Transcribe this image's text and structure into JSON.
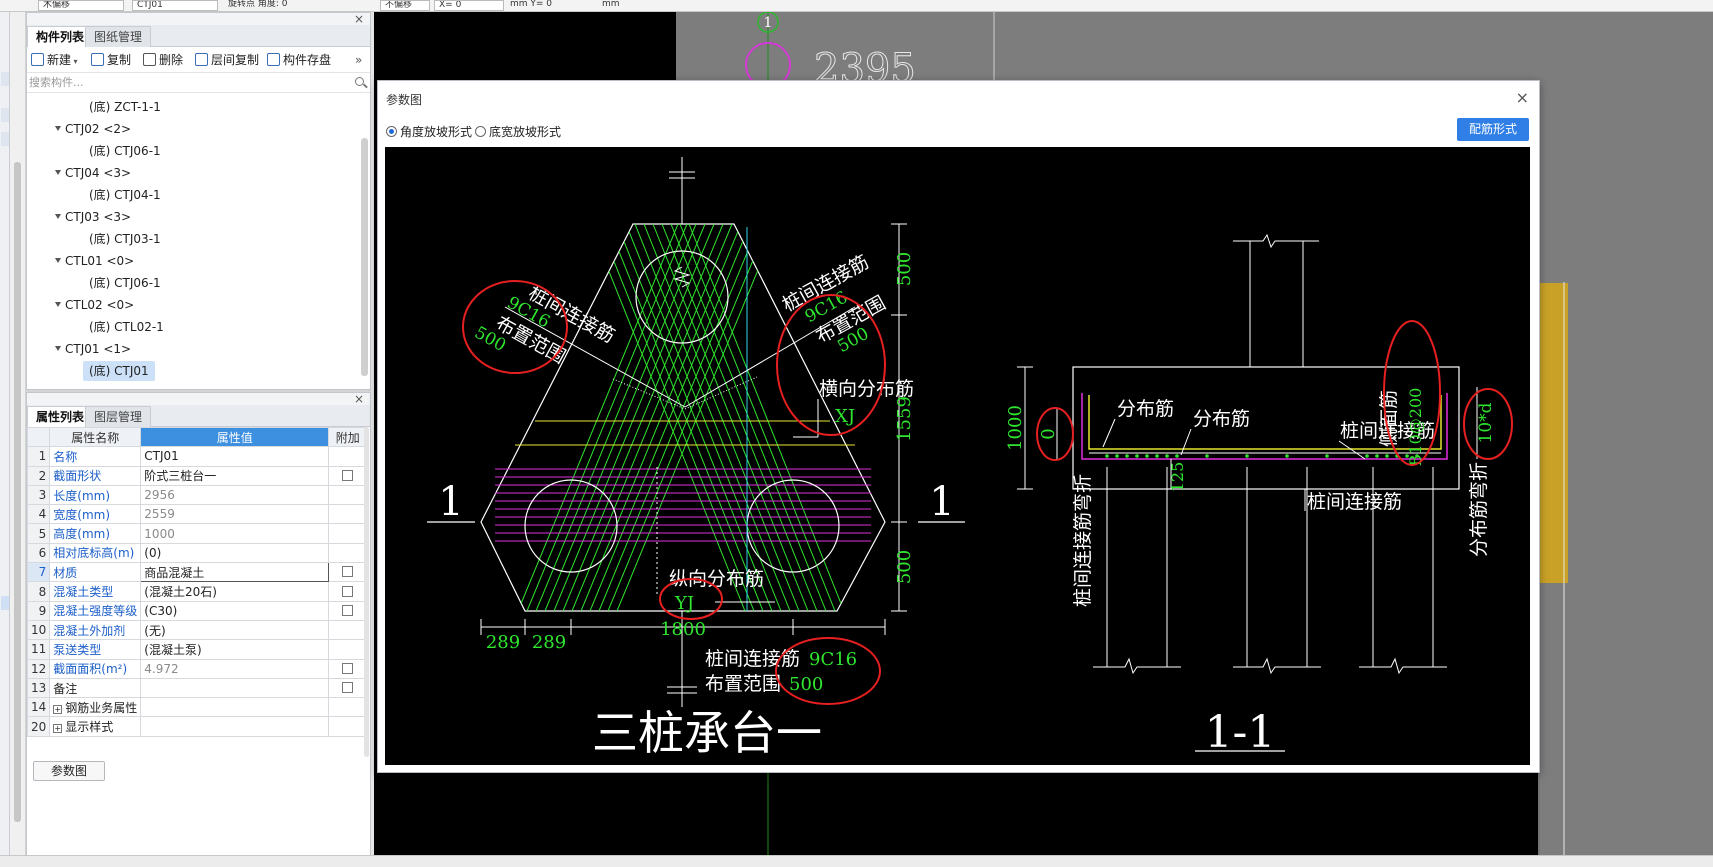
{
  "top_toolbar": {
    "items": [
      {
        "text": "木偏移"
      },
      {
        "text": "CTJ01"
      },
      {
        "text": "旋转点 角度: 0"
      },
      {
        "text": "不偏移"
      },
      {
        "text": "X= 0"
      },
      {
        "text": "mm Y= 0"
      },
      {
        "text": "mm"
      }
    ]
  },
  "component_panel": {
    "tabs": [
      "构件列表",
      "图纸管理"
    ],
    "toolbar": [
      "新建",
      "复制",
      "删除",
      "层间复制",
      "构件存盘"
    ],
    "overflow": "»",
    "search_placeholder": "搜索构件...",
    "tree": [
      {
        "text": "(底) ZCT-1-1",
        "level": 2
      },
      {
        "text": "CTJ02 <2>",
        "level": 1
      },
      {
        "text": "(底) CTJ06-1",
        "level": 2
      },
      {
        "text": "CTJ04 <3>",
        "level": 1
      },
      {
        "text": "(底) CTJ04-1",
        "level": 2
      },
      {
        "text": "CTJ03 <3>",
        "level": 1
      },
      {
        "text": "(底) CTJ03-1",
        "level": 2
      },
      {
        "text": "CTL01 <0>",
        "level": 1
      },
      {
        "text": "(底) CTJ06-1",
        "level": 2
      },
      {
        "text": "CTL02 <0>",
        "level": 1
      },
      {
        "text": "(底) CTL02-1",
        "level": 2
      },
      {
        "text": "CTJ01 <1>",
        "level": 1
      },
      {
        "text": "(底) CTJ01",
        "level": 2,
        "selected": true
      }
    ]
  },
  "property_panel": {
    "tabs": [
      "属性列表",
      "图层管理"
    ],
    "headers": [
      "属性名称",
      "属性值",
      "附加"
    ],
    "rows": [
      {
        "no": "1",
        "name": "名称",
        "value": "CTJ01",
        "blue": true,
        "gray": false,
        "check": false
      },
      {
        "no": "2",
        "name": "截面形状",
        "value": "阶式三桩台一",
        "blue": true,
        "gray": false,
        "check": true
      },
      {
        "no": "3",
        "name": "长度(mm)",
        "value": "2956",
        "blue": true,
        "gray": true,
        "check": false
      },
      {
        "no": "4",
        "name": "宽度(mm)",
        "value": "2559",
        "blue": true,
        "gray": true,
        "check": false
      },
      {
        "no": "5",
        "name": "高度(mm)",
        "value": "1000",
        "blue": true,
        "gray": true,
        "check": false
      },
      {
        "no": "6",
        "name": "相对底标高(m)",
        "value": "(0)",
        "blue": true,
        "gray": false,
        "check": false
      },
      {
        "no": "7",
        "name": "材质",
        "value": "商品混凝土",
        "blue": true,
        "gray": false,
        "check": true,
        "editing": true
      },
      {
        "no": "8",
        "name": "混凝土类型",
        "value": "(混凝土20石)",
        "blue": true,
        "gray": false,
        "check": true
      },
      {
        "no": "9",
        "name": "混凝土强度等级",
        "value": "(C30)",
        "blue": true,
        "gray": false,
        "check": true
      },
      {
        "no": "10",
        "name": "混凝土外加剂",
        "value": "(无)",
        "blue": true,
        "gray": false,
        "check": false
      },
      {
        "no": "11",
        "name": "泵送类型",
        "value": "(混凝土泵)",
        "blue": true,
        "gray": false,
        "check": false
      },
      {
        "no": "12",
        "name": "截面面积(m²)",
        "value": "4.972",
        "blue": true,
        "gray": true,
        "check": true
      },
      {
        "no": "13",
        "name": "备注",
        "value": "",
        "blue": false,
        "gray": false,
        "check": true
      },
      {
        "no": "14",
        "name": "钢筋业务属性",
        "value": "",
        "blue": false,
        "gray": false,
        "check": false,
        "expand": true
      },
      {
        "no": "20",
        "name": "显示样式",
        "value": "",
        "blue": false,
        "gray": false,
        "check": false,
        "expand": true
      }
    ],
    "param_button": "参数图"
  },
  "background_cad": {
    "axis_label": "1",
    "dimension": "2395"
  },
  "dialog": {
    "title": "参数图",
    "close": "×",
    "radio_options": [
      "角度放坡形式",
      "底宽放坡形式"
    ],
    "selected_radio": 0,
    "rebar_button": "配筋形式",
    "drawing": {
      "plan_title": "三桩承台一",
      "section_title": "1-1",
      "section_mark": "1",
      "plan_labels": {
        "left_rebar": "桩间连接筋",
        "left_value": "9C16",
        "left_range": "布置范围",
        "left_range_value": "500",
        "right_rebar": "桩间连接筋",
        "right_value": "9C16",
        "right_range": "布置范围",
        "right_range_value": "500",
        "transverse": "横向分布筋",
        "transverse_value": "XJ",
        "longitudinal": "纵向分布筋",
        "longitudinal_value": "YJ",
        "bottom_rebar": "桩间连接筋",
        "bottom_value": "9C16",
        "bottom_range": "布置范围",
        "bottom_range_value": "500",
        "dim_500_top": "500",
        "dim_1559": "1559",
        "dim_500_bottom": "500",
        "dim_289_a": "289",
        "dim_289_b": "289",
        "dim_1800": "1800"
      },
      "section_labels": {
        "dim_1000": "1000",
        "bend_value": "0",
        "bend_label": "桩间连接筋弯折",
        "dist_a": "分布筋",
        "dist_b": "分布筋",
        "side_label": "侧面筋",
        "side_value": "B10@200",
        "pile_conn": "桩间连接筋",
        "dim_125": "125",
        "pile_conn_bottom": "桩间连接筋",
        "dist_bend_value": "10*d",
        "dist_bend_label": "分布筋弯折"
      }
    }
  }
}
